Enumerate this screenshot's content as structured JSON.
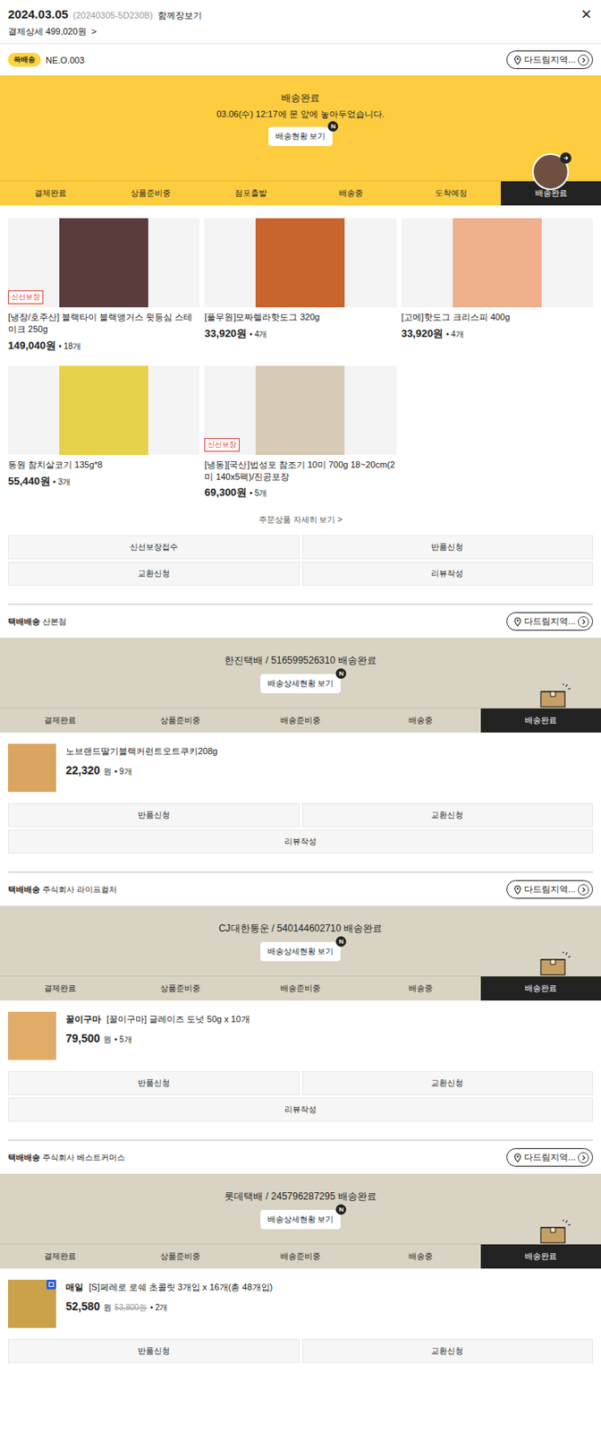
{
  "header": {
    "date": "2024.03.05",
    "order_id": "(20240305-5D230B)",
    "label": "함께장보기",
    "close": "×",
    "payment": "결제상세 499,020원",
    "payment_arrow": ">"
  },
  "main_delivery": {
    "badge": "쓱배송",
    "code": "NE.O.003",
    "region": "다드림지역...",
    "status_title": "배송완료",
    "status_msg": "03.06(수) 12:17에 문 앞에 놓아두었습니다.",
    "button": "배송현황 보기",
    "new_badge": "N",
    "steps": [
      {
        "label": "결제완료",
        "selected": false
      },
      {
        "label": "상품준비중",
        "selected": false
      },
      {
        "label": "점포출발",
        "selected": false
      },
      {
        "label": "배송중",
        "selected": false
      },
      {
        "label": "도착예정",
        "selected": false
      },
      {
        "label": "배송완료",
        "selected": true
      }
    ],
    "products": [
      {
        "name": "[냉장/호주산] 블랙타이 블랙앵거스 윗등심 스테이크 250g",
        "price": "149,040원",
        "qty": "• 18개",
        "badge": "신선보장",
        "color": "#5a3c3c"
      },
      {
        "name": "[풀무원]모짜렐라핫도그 320g",
        "price": "33,920원",
        "qty": "• 4개",
        "badge": null,
        "color": "#c8642e"
      },
      {
        "name": "[고메]핫도그 크리스피 400g",
        "price": "33,920원",
        "qty": "• 4개",
        "badge": null,
        "color": "#efb08c"
      },
      {
        "name": "동원 참치살코기 135g*8",
        "price": "55,440원",
        "qty": "• 3개",
        "badge": null,
        "color": "#e6d24a"
      },
      {
        "name": "[냉동][국산]법성포 참조기 10미 700g 18~20cm(2미 140x5팩)/진공포장",
        "price": "69,300원",
        "qty": "• 5개",
        "badge": "신선보장",
        "color": "#d8cbb6"
      }
    ],
    "more_link": "주문상품 자세히 보기 >",
    "actions": [
      "신선보장접수",
      "반품신청",
      "교환신청",
      "리뷰작성"
    ]
  },
  "parcels": [
    {
      "type": "택배배송",
      "seller": "산본점",
      "region": "다드림지역...",
      "carrier": "한진택배 / 516599526310 배송완료",
      "button": "배송상세현황 보기",
      "new_badge": "N",
      "steps": [
        {
          "label": "결제완료",
          "selected": false
        },
        {
          "label": "상품준비중",
          "selected": false
        },
        {
          "label": "배송준비중",
          "selected": false
        },
        {
          "label": "배송중",
          "selected": false
        },
        {
          "label": "배송완료",
          "selected": true
        }
      ],
      "product": {
        "brand": null,
        "name": "노브랜드딸기블랙커런트오트쿠키208g",
        "price": "22,320",
        "unit": "원",
        "original_price": null,
        "qty": "• 9개",
        "icon_badge": false,
        "color": "#d9a560"
      },
      "actions": [
        "반품신청",
        "교환신청",
        "리뷰작성"
      ]
    },
    {
      "type": "택배배송",
      "seller": "주식회사 라이프컬처",
      "region": "다드림지역...",
      "carrier": "CJ대한통운 / 540144602710 배송완료",
      "button": "배송상세현황 보기",
      "new_badge": "N",
      "steps": [
        {
          "label": "결제완료",
          "selected": false
        },
        {
          "label": "상품준비중",
          "selected": false
        },
        {
          "label": "배송준비중",
          "selected": false
        },
        {
          "label": "배송중",
          "selected": false
        },
        {
          "label": "배송완료",
          "selected": true
        }
      ],
      "product": {
        "brand": "꿀이구마",
        "name": "[꿀이구마] 글레이즈 도넛 50g x 10개",
        "price": "79,500",
        "unit": "원",
        "original_price": null,
        "qty": "• 5개",
        "icon_badge": false,
        "color": "#e0ac6a"
      },
      "actions": [
        "반품신청",
        "교환신청",
        "리뷰작성"
      ]
    },
    {
      "type": "택배배송",
      "seller": "주식회사 베스트커머스",
      "region": "다드림지역...",
      "carrier": "롯데택배 / 245796287295 배송완료",
      "button": "배송상세현황 보기",
      "new_badge": "N",
      "steps": [
        {
          "label": "결제완료",
          "selected": false
        },
        {
          "label": "상품준비중",
          "selected": false
        },
        {
          "label": "배송준비중",
          "selected": false
        },
        {
          "label": "배송중",
          "selected": false
        },
        {
          "label": "배송완료",
          "selected": true
        }
      ],
      "product": {
        "brand": "매일",
        "name": "[S]페레로 로쉐 초콜릿 3개입 x 16개(총 48개입)",
        "price": "52,580",
        "unit": "원",
        "original_price": "53,800원",
        "qty": "• 2개",
        "icon_badge": true,
        "color": "#c9a24a"
      },
      "actions": [
        "반품신청",
        "교환신청"
      ]
    }
  ]
}
